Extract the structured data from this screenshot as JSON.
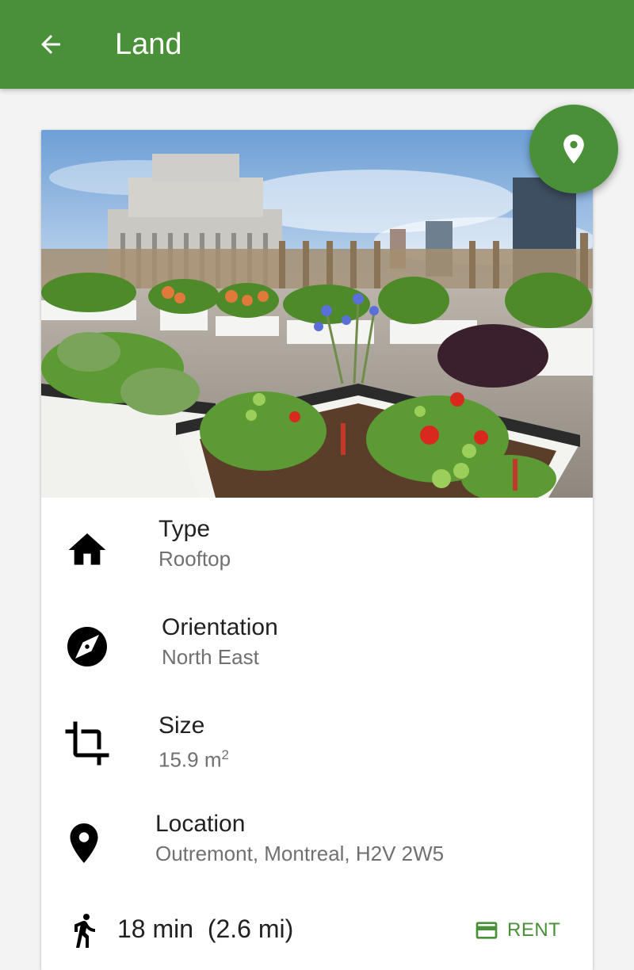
{
  "app_bar": {
    "title": "Land",
    "back_icon": "arrow-back-icon",
    "color": "#4a9038"
  },
  "hero_image": {
    "description_icon": "rooftop-garden-photo"
  },
  "fab": {
    "icon": "map-pin-icon"
  },
  "details": [
    {
      "icon": "home-icon",
      "label": "Type",
      "value": "Rooftop"
    },
    {
      "icon": "compass-icon",
      "label": "Orientation",
      "value": "North East"
    },
    {
      "icon": "crop-icon",
      "label": "Size",
      "value": "15.9 m",
      "unit_superscript": "2"
    },
    {
      "icon": "location-pin-icon",
      "label": "Location",
      "value": "Outremont, Montreal, H2V 2W5"
    }
  ],
  "footer": {
    "walk_icon": "walking-icon",
    "walk_text": "18 min  (2.6 mi)",
    "rent_icon": "credit-card-icon",
    "rent_label": "RENT"
  }
}
